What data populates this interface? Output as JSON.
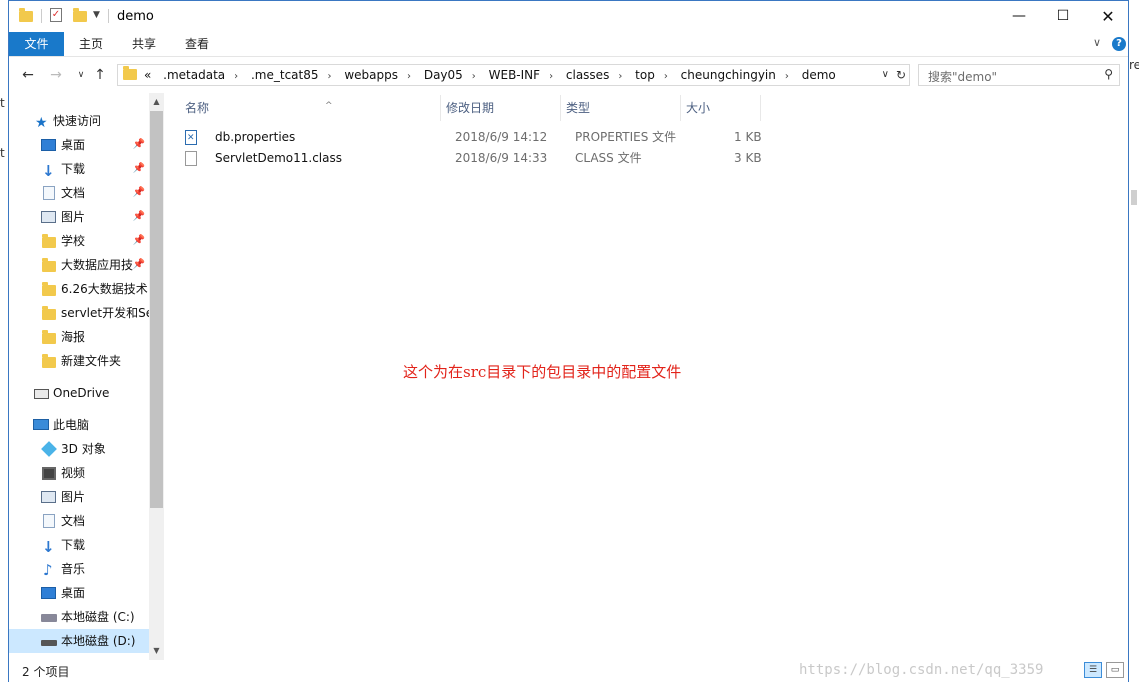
{
  "window": {
    "title": "demo"
  },
  "ribbon": {
    "tabs": [
      "文件",
      "主页",
      "共享",
      "查看"
    ]
  },
  "address": {
    "overflow": "«",
    "crumbs": [
      ".metadata",
      ".me_tcat85",
      "webapps",
      "Day05",
      "WEB-INF",
      "classes",
      "top",
      "cheungchingyin",
      "demo"
    ]
  },
  "search": {
    "placeholder": "搜索\"demo\""
  },
  "sidebar": {
    "items": [
      {
        "label": "快速访问",
        "icon": "star-icon",
        "pinned": false
      },
      {
        "label": "桌面",
        "icon": "desktop-icon",
        "pinned": true
      },
      {
        "label": "下载",
        "icon": "download-icon",
        "pinned": true
      },
      {
        "label": "文档",
        "icon": "document-icon",
        "pinned": true
      },
      {
        "label": "图片",
        "icon": "picture-icon",
        "pinned": true
      },
      {
        "label": "学校",
        "icon": "folder-icon",
        "pinned": true
      },
      {
        "label": "大数据应用技",
        "icon": "folder-icon",
        "pinned": true
      },
      {
        "label": "6.26大数据技术·",
        "icon": "folder-icon",
        "pinned": false
      },
      {
        "label": "servlet开发和Se",
        "icon": "folder-icon",
        "pinned": false
      },
      {
        "label": "海报",
        "icon": "folder-icon",
        "pinned": false
      },
      {
        "label": "新建文件夹",
        "icon": "folder-icon",
        "pinned": false
      },
      {
        "label": "OneDrive",
        "icon": "onedrive-icon",
        "pinned": false
      },
      {
        "label": "此电脑",
        "icon": "computer-icon",
        "pinned": false
      },
      {
        "label": "3D 对象",
        "icon": "3d-objects-icon",
        "pinned": false
      },
      {
        "label": "视频",
        "icon": "video-icon",
        "pinned": false
      },
      {
        "label": "图片",
        "icon": "picture-icon",
        "pinned": false
      },
      {
        "label": "文档",
        "icon": "document-icon",
        "pinned": false
      },
      {
        "label": "下载",
        "icon": "download-icon",
        "pinned": false
      },
      {
        "label": "音乐",
        "icon": "music-icon",
        "pinned": false
      },
      {
        "label": "桌面",
        "icon": "desktop-icon",
        "pinned": false
      },
      {
        "label": "本地磁盘 (C:)",
        "icon": "drive-icon",
        "pinned": false
      },
      {
        "label": "本地磁盘 (D:)",
        "icon": "drive-icon",
        "pinned": false,
        "selected": true
      }
    ]
  },
  "columns": {
    "name": "名称",
    "modified": "修改日期",
    "type": "类型",
    "size": "大小"
  },
  "files": [
    {
      "name": "db.properties",
      "modified": "2018/6/9 14:12",
      "type": "PROPERTIES 文件",
      "size": "1 KB"
    },
    {
      "name": "ServletDemo11.class",
      "modified": "2018/6/9 14:33",
      "type": "CLASS 文件",
      "size": "3 KB"
    }
  ],
  "annotation": "这个为在src目录下的包目录中的配置文件",
  "status": {
    "count": "2 个项目"
  },
  "watermark": "https://blog.csdn.net/qq_3359",
  "background_fragments": {
    "left": [
      "t",
      "t"
    ],
    "right": [
      "re"
    ]
  },
  "colors": {
    "accent": "#1979ca",
    "selection": "#cce8ff",
    "annotation": "#e2231a",
    "header_text": "#4d6082"
  }
}
